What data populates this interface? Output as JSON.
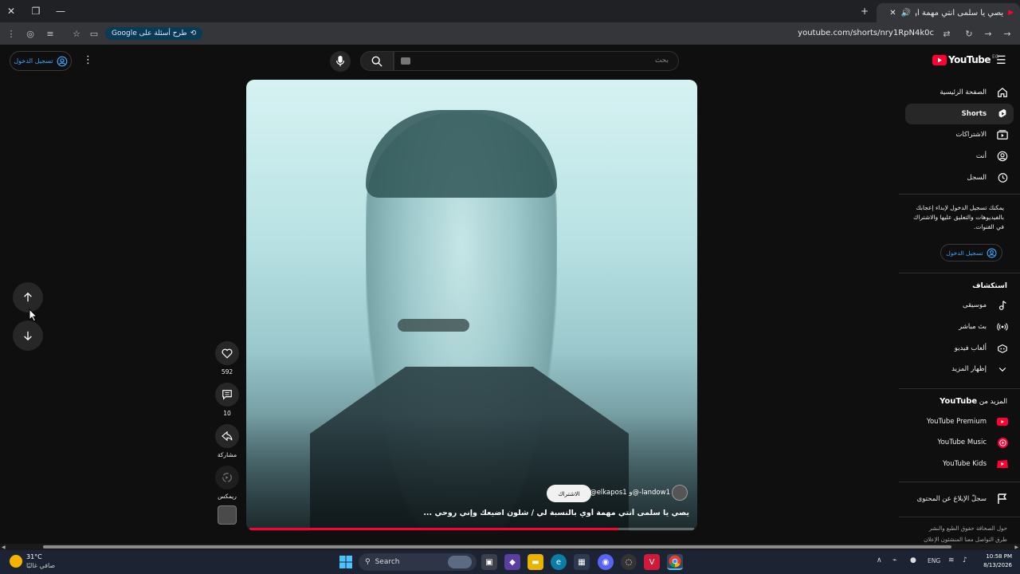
{
  "browser": {
    "tab_title": "يصي يا سلمى أنتي مهمة أوي",
    "url": "youtube.com/shorts/nry1RpN4k0c",
    "ask_google": "طرح أسئلة على Google"
  },
  "header": {
    "signin": "تسجيل الدخول",
    "search_placeholder": "بحث",
    "logo": "YouTube",
    "country": "EG"
  },
  "sidebar": {
    "items": [
      {
        "label": "الصفحة الرئيسية",
        "icon": "home-icon"
      },
      {
        "label": "Shorts",
        "icon": "shorts-icon"
      },
      {
        "label": "الاشتراكات",
        "icon": "subscriptions-icon"
      },
      {
        "label": "أنت",
        "icon": "you-icon"
      },
      {
        "label": "السجل",
        "icon": "history-icon"
      }
    ],
    "signin_prompt": "يمكنك تسجيل الدخول لإبداء إعجابك بالفيديوهات والتعليق عليها والاشتراك في القنوات.",
    "signin_button": "تسجيل الدخول",
    "explore_title": "استكشاف",
    "explore": [
      {
        "label": "موسيقى",
        "icon": "music-icon"
      },
      {
        "label": "بث مباشر",
        "icon": "live-icon"
      },
      {
        "label": "ألعاب فيديو",
        "icon": "gaming-icon"
      },
      {
        "label": "إظهار المزيد",
        "icon": "chevron-down-icon"
      }
    ],
    "more_title_prefix": "المزيد من",
    "more_title_brand": "YouTube",
    "more": [
      {
        "label": "YouTube Premium",
        "icon": "youtube-premium-icon"
      },
      {
        "label": "YouTube Music",
        "icon": "youtube-music-icon"
      },
      {
        "label": "YouTube Kids",
        "icon": "youtube-kids-icon"
      }
    ],
    "report": "سجلّ الإبلاغ عن المحتوى",
    "footer_1": "حول  الصحافة  حقوق الطبع والنشر",
    "footer_2": "طرق التواصل معنا  المنشئون  الإعلان"
  },
  "short": {
    "likes": "592",
    "comments": "10",
    "share": "مشاركة",
    "remix": "ريمكس",
    "channel": "@elkapos1 و@-landow1",
    "subscribe": "الاشتراك",
    "title": "يصي يا سلمى أنتي مهمة أوي بالنسبة لي / شلون اضيعك وإني روحي ...",
    "progress": 0.83
  },
  "taskbar": {
    "weather_temp": "31°C",
    "weather_desc": "صافي غالبًا",
    "search": "Search",
    "lang": "ENG",
    "time": "10:58 PM",
    "date": "8/13/2026"
  }
}
